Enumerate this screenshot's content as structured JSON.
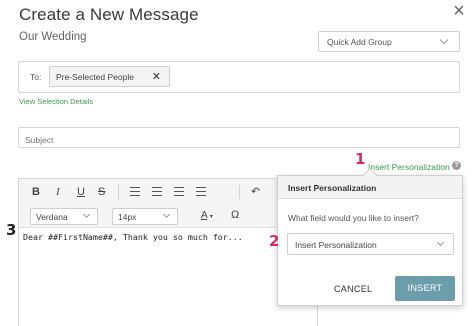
{
  "header": {
    "title": "Create a New Message",
    "subtitle": "Our Wedding",
    "close_icon": "close-icon"
  },
  "quick_add": {
    "value": "Quick Add Group"
  },
  "recipients": {
    "to_label": "To:",
    "chip_label": "Pre-Selected People",
    "chip_remove": "✕",
    "view_selection": "View Selection Details"
  },
  "subject": {
    "placeholder": "Subject"
  },
  "personalization": {
    "link": "Insert Personalization",
    "help_icon": "?"
  },
  "toolbar": {
    "bold": "B",
    "italic": "I",
    "underline": "U",
    "strike": "S",
    "undo": "↶",
    "font": "Verdana",
    "size": "14px",
    "text_color": "A",
    "omega": "Ω",
    "icons": [
      "bold-icon",
      "italic-icon",
      "underline-icon",
      "strikethrough-icon",
      "align-left-icon",
      "align-center-icon",
      "align-right-icon",
      "align-justify-icon",
      "undo-icon",
      "text-color-icon",
      "special-character-icon"
    ]
  },
  "editor": {
    "body": "Dear ##FirstName##, Thank you so much for..."
  },
  "popover": {
    "title": "Insert Personalization",
    "question": "What field would you like to insert?",
    "select_value": "Insert Personalization",
    "cancel": "CANCEL",
    "insert": "INSERT"
  },
  "callouts": [
    "1",
    "2",
    "3"
  ],
  "colors": {
    "link_green": "#3a9a4a",
    "callout_pink": "#d12d6e",
    "insert_button": "#6b9dab"
  }
}
